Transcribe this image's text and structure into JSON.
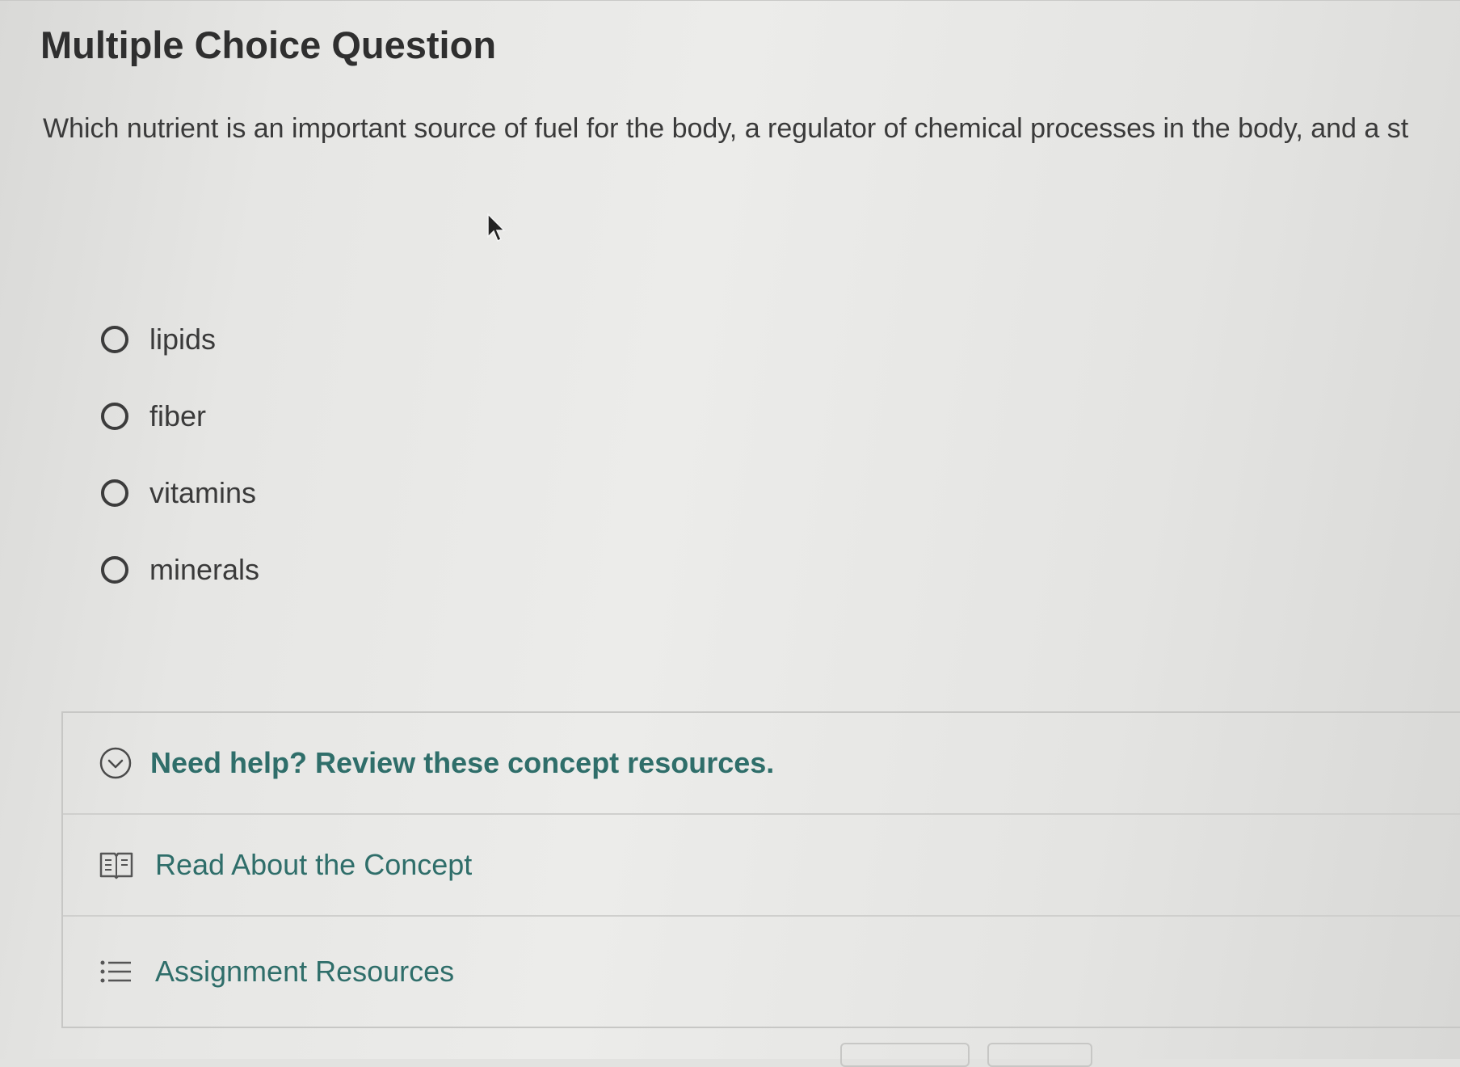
{
  "title": "Multiple Choice Question",
  "question": "Which nutrient is an important source of fuel for the body, a regulator of chemical processes in the body, and a st",
  "options": [
    {
      "label": "lipids"
    },
    {
      "label": "fiber"
    },
    {
      "label": "vitamins"
    },
    {
      "label": "minerals"
    }
  ],
  "help": {
    "header_label": "Need help? Review these concept resources.",
    "header_icon": "chevron-circle-down-icon",
    "read_concept_label": "Read About the Concept",
    "read_concept_icon": "book-icon",
    "assignment_resources_label": "Assignment Resources",
    "assignment_resources_icon": "list-icon"
  },
  "colors": {
    "accent_teal": "#2f6e6a",
    "text": "#3a3a3a"
  }
}
